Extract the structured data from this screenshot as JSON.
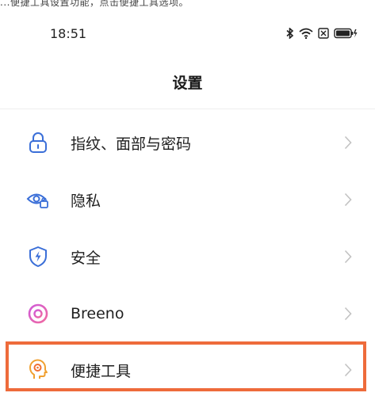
{
  "caption": "...便捷工具设置功能，点击便捷工具选项。",
  "status_bar": {
    "time": "18:51",
    "icons": [
      "bluetooth-icon",
      "wifi-icon",
      "sim-icon",
      "battery-icon"
    ]
  },
  "page": {
    "title": "设置"
  },
  "settings_items": [
    {
      "label": "指纹、面部与密码",
      "icon": "lock-icon"
    },
    {
      "label": "隐私",
      "icon": "privacy-eye-icon"
    },
    {
      "label": "安全",
      "icon": "security-shield-icon"
    },
    {
      "label": "Breeno",
      "icon": "breeno-icon"
    },
    {
      "label": "便捷工具",
      "icon": "convenience-tools-icon",
      "highlighted": true
    }
  ],
  "colors": {
    "accent_blue": "#3b6fd8",
    "highlight_border": "#ee6b3b",
    "chevron": "#c2c2c2",
    "divider": "#eeeeee"
  }
}
